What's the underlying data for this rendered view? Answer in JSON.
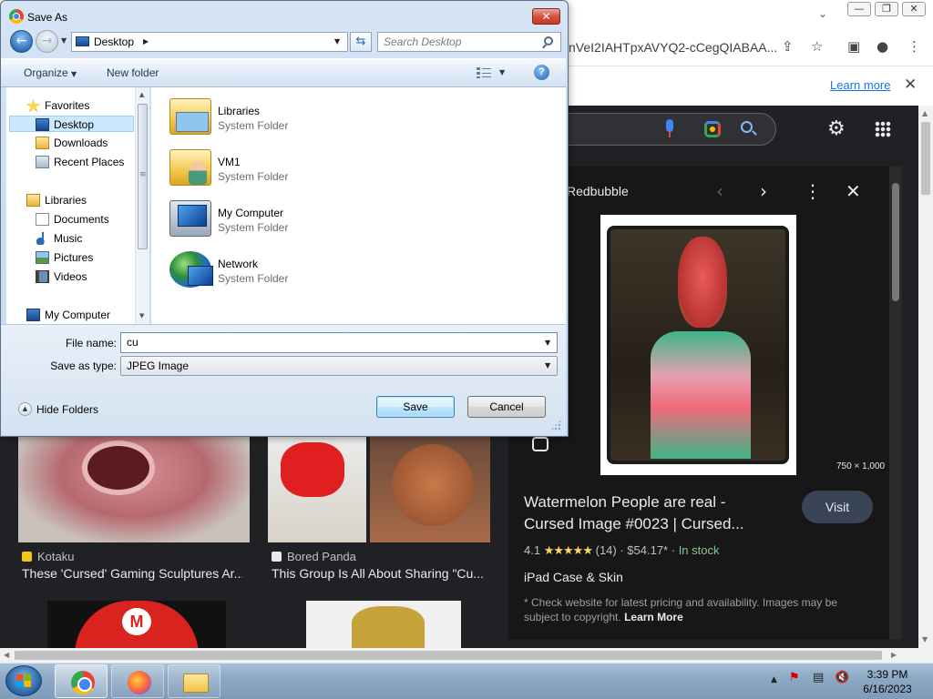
{
  "browser": {
    "url_fragment": "nVeI2IAHTpxAVYQ2-cCegQIABAA...",
    "infobar_link": "Learn more",
    "window_buttons": [
      "—",
      "❐",
      "✕"
    ]
  },
  "result_panel": {
    "source_name": "Redbubble",
    "image_dims": "750 × 1,000",
    "title": "Watermelon People are real - Cursed Image #0023 | Cursed...",
    "visit_label": "Visit",
    "rating": "4.1",
    "stars": "★★★★★",
    "reviews": "(14)",
    "price": "$54.17*",
    "stock": "In stock",
    "product": "iPad Case & Skin",
    "disclaimer": "* Check website for latest pricing and availability. Images may be subject to copyright.",
    "disclaimer_link": "Learn More"
  },
  "results": [
    {
      "source": "Kotaku",
      "caption": "These 'Cursed' Gaming Sculptures Ar...",
      "fav_color": "#f5c518"
    },
    {
      "source": "Bored Panda",
      "caption": "This Group Is All About Sharing \"Cu...",
      "fav_color": "#e8eaed"
    }
  ],
  "dialog": {
    "title": "Save As",
    "address": "Desktop",
    "search_placeholder": "Search Desktop",
    "organize_label": "Organize",
    "new_folder_label": "New folder",
    "nav": {
      "favorites": "Favorites",
      "desktop": "Desktop",
      "downloads": "Downloads",
      "recent_places": "Recent Places",
      "libraries": "Libraries",
      "documents": "Documents",
      "music": "Music",
      "pictures": "Pictures",
      "videos": "Videos",
      "my_computer": "My Computer"
    },
    "files": [
      {
        "name": "Libraries",
        "type": "System Folder"
      },
      {
        "name": "VM1",
        "type": "System Folder"
      },
      {
        "name": "My Computer",
        "type": "System Folder"
      },
      {
        "name": "Network",
        "type": "System Folder"
      }
    ],
    "file_name_label": "File name:",
    "file_name_value": "cu",
    "save_type_label": "Save as type:",
    "save_type_value": "JPEG Image",
    "hide_folders_label": "Hide Folders",
    "save_label": "Save",
    "cancel_label": "Cancel"
  },
  "taskbar": {
    "time": "3:39 PM",
    "date": "6/16/2023"
  },
  "colors": {
    "google_bg": "#202124",
    "accent_link": "#1a73e8",
    "in_stock": "#81c995",
    "dialog_chrome": "#c6d8ee"
  }
}
